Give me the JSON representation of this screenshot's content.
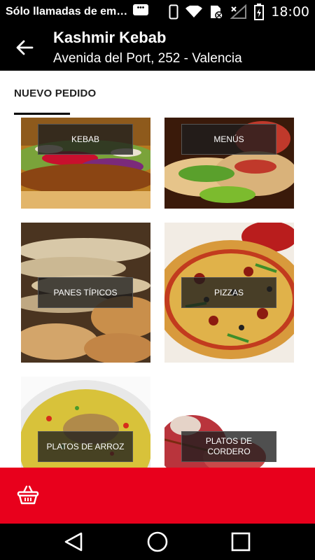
{
  "status_bar": {
    "notification_text": "Sólo llamadas de em…",
    "notif_icon_text": "•••",
    "time": "18:00",
    "icons": [
      "message-icon",
      "phone-outline-icon",
      "wifi-icon",
      "sim-off-icon",
      "no-signal-icon",
      "battery-icon"
    ]
  },
  "app_bar": {
    "title": "Kashmir Kebab",
    "subtitle": "Avenida del Port, 252 - Valencia",
    "back_icon": "arrow-back-icon"
  },
  "tabs": [
    {
      "label": "NUEVO PEDIDO",
      "selected": true
    }
  ],
  "categories": [
    {
      "label": "KEBAB"
    },
    {
      "label": "MENÚS"
    },
    {
      "label": "PANES TÍPICOS"
    },
    {
      "label": "PIZZAS"
    },
    {
      "label": "PLATOS DE ARROZ"
    },
    {
      "label": "PLATOS DE CORDERO"
    }
  ],
  "cart_bar": {
    "icon": "basket-icon",
    "color": "#e8001c"
  },
  "nav_bar": {
    "icons": [
      "back-triangle-icon",
      "home-circle-icon",
      "recents-square-icon"
    ]
  }
}
